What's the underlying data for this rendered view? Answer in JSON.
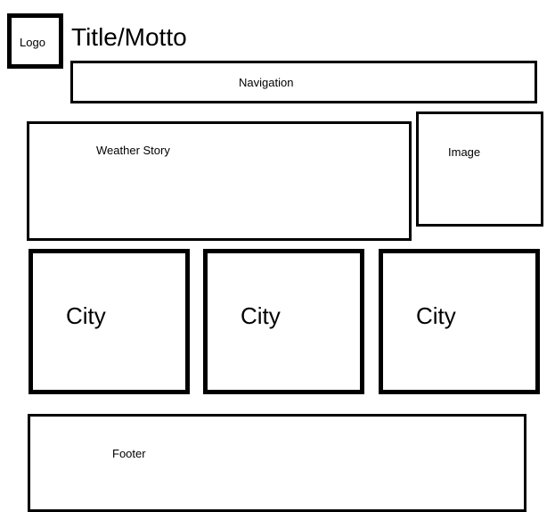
{
  "header": {
    "logo_label": "Logo",
    "title": "Title/Motto"
  },
  "navigation": {
    "label": "Navigation"
  },
  "content": {
    "weather_story_label": "Weather Story",
    "image_label": "Image"
  },
  "cities": [
    {
      "label": "City"
    },
    {
      "label": "City"
    },
    {
      "label": "City"
    }
  ],
  "footer": {
    "label": "Footer"
  }
}
